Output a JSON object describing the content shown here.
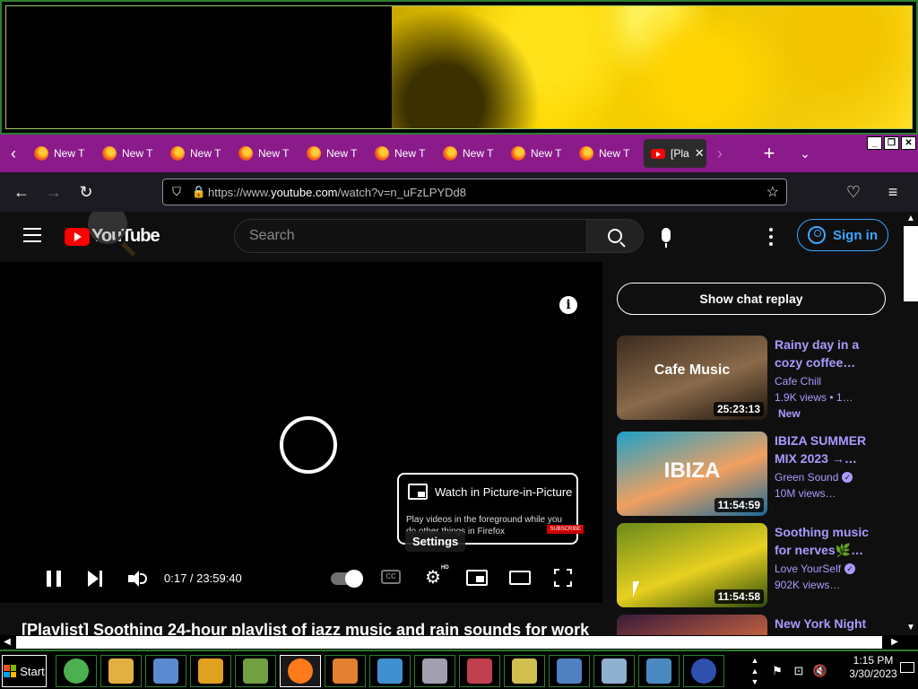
{
  "tabs": [
    {
      "label": "New T",
      "icon": "firefox-icon"
    },
    {
      "label": "New T",
      "icon": "firefox-icon"
    },
    {
      "label": "New T",
      "icon": "firefox-icon"
    },
    {
      "label": "New T",
      "icon": "firefox-icon"
    },
    {
      "label": "New T",
      "icon": "firefox-icon"
    },
    {
      "label": "New T",
      "icon": "firefox-icon"
    },
    {
      "label": "New T",
      "icon": "firefox-icon"
    },
    {
      "label": "New T",
      "icon": "firefox-icon"
    },
    {
      "label": "New T",
      "icon": "firefox-icon"
    }
  ],
  "active_tab": {
    "label": "[Pla",
    "icon": "youtube-icon"
  },
  "url": {
    "prefix": "https://www.",
    "host": "youtube.com",
    "path": "/watch?v=n_uFzLPYDd8"
  },
  "youtube": {
    "logo_text": "YouTube",
    "search_placeholder": "Search",
    "sign_in": "Sign in",
    "show_chat_replay": "Show chat replay"
  },
  "player": {
    "time": "0:17 / 23:59:40",
    "pip_title": "Watch in Picture-in-Picture",
    "pip_desc": "Play videos in the foreground while you do other things in Firefox",
    "subscribe": "SUBSCRIBE",
    "settings_tooltip": "Settings",
    "hd_badge": "HD",
    "cc_label": "CC"
  },
  "video_title": "[Playlist] Soothing 24-hour playlist of jazz music and rain sounds for work",
  "recommendations": [
    {
      "title": "Rainy day in a cozy coffee…",
      "channel": "Cafe Chill",
      "verified": false,
      "meta": "1.9K views  •  1…",
      "badge": "New",
      "duration": "25:23:13",
      "overlay": "Cafe Music",
      "colors": [
        "#3b2a1e",
        "#8a6a4a",
        "#1e140e"
      ]
    },
    {
      "title": "IBIZA SUMMER MIX 2023 →…",
      "channel": "Green Sound",
      "verified": true,
      "meta": "10M views…",
      "badge": "",
      "duration": "11:54:59",
      "overlay": "IBIZA",
      "colors": [
        "#1fa0c8",
        "#f0a060",
        "#1a6a9a"
      ]
    },
    {
      "title": "Soothing music for nerves🌿…",
      "channel": "Love YourSelf",
      "verified": true,
      "meta": "902K views…",
      "badge": "",
      "duration": "11:54:58",
      "overlay": "",
      "colors": [
        "#6a8a1a",
        "#e8d020",
        "#2a4a0a"
      ]
    },
    {
      "title": "New York Night",
      "channel": "",
      "verified": false,
      "meta": "",
      "badge": "",
      "duration": "",
      "overlay": "",
      "colors": [
        "#3a1a3a",
        "#c06040",
        "#1a0a1a"
      ]
    }
  ],
  "taskbar": {
    "start_label": "Start",
    "apps": [
      {
        "name": "chrome-icon",
        "color": "#4caf50"
      },
      {
        "name": "file-explorer-icon",
        "color": "#e0b040"
      },
      {
        "name": "my-computer-icon",
        "color": "#5a8ad0"
      },
      {
        "name": "search-tool-icon",
        "color": "#e0a020"
      },
      {
        "name": "chart-app-icon",
        "color": "#70a040"
      },
      {
        "name": "firefox-icon",
        "color": "#ff7a1a"
      },
      {
        "name": "media-player-icon",
        "color": "#e08030"
      },
      {
        "name": "send-icon",
        "color": "#4090d0"
      },
      {
        "name": "calculator-icon",
        "color": "#a0a0b0"
      },
      {
        "name": "snipping-tool-icon",
        "color": "#c04050"
      },
      {
        "name": "sticky-notes-icon",
        "color": "#d0c050"
      },
      {
        "name": "remote-desktop-icon",
        "color": "#5080c0"
      },
      {
        "name": "notepad-icon",
        "color": "#90b0d0"
      },
      {
        "name": "control-panel-icon",
        "color": "#4a8ac0"
      },
      {
        "name": "help-icon",
        "color": "#3050b0"
      }
    ],
    "time": "1:15 PM",
    "date": "3/30/2023"
  }
}
